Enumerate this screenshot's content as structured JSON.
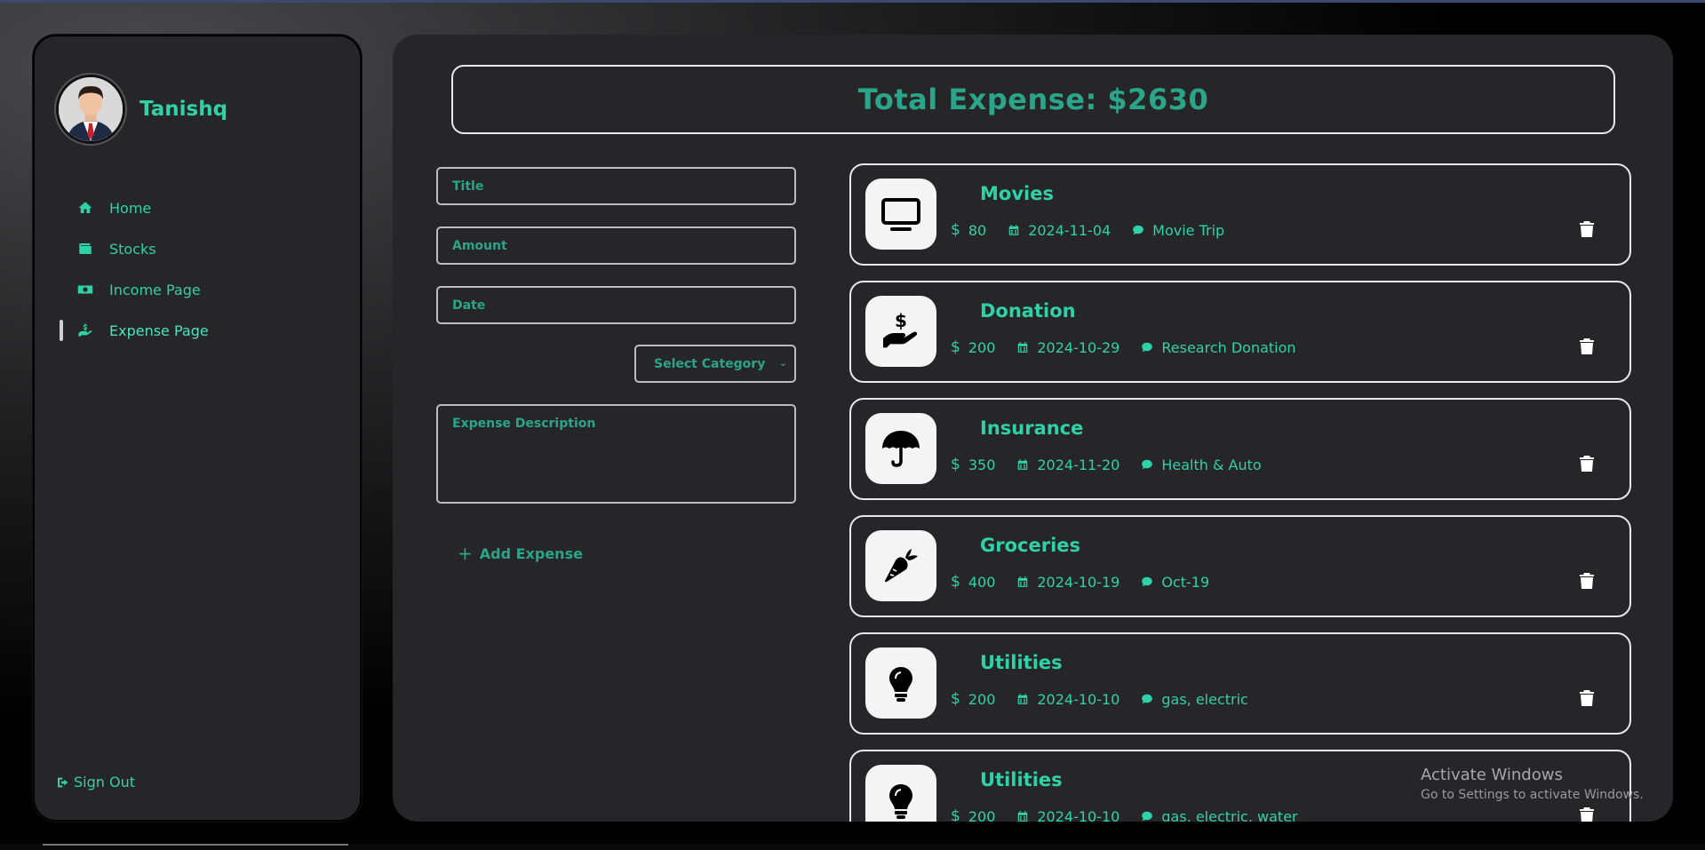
{
  "user": {
    "name": "Tanishq"
  },
  "nav": [
    {
      "label": "Home",
      "icon": "home-icon",
      "active": false
    },
    {
      "label": "Stocks",
      "icon": "wallet-icon",
      "active": false
    },
    {
      "label": "Income Page",
      "icon": "money-bill-icon",
      "active": false
    },
    {
      "label": "Expense Page",
      "icon": "hand-holding-dollar-icon",
      "active": true
    }
  ],
  "signout": {
    "label": "Sign Out"
  },
  "total": {
    "label": "Total Expense: $2630"
  },
  "form": {
    "title_placeholder": "Title",
    "amount_placeholder": "Amount",
    "date_placeholder": "Date",
    "category_selected": "Select Category",
    "description_placeholder": "Expense Description",
    "add_label": "Add Expense"
  },
  "expenses": [
    {
      "title": "Movies",
      "amount": "80",
      "date": "2024-11-04",
      "note": "Movie Trip",
      "icon": "tv-icon"
    },
    {
      "title": "Donation",
      "amount": "200",
      "date": "2024-10-29",
      "note": "Research Donation",
      "icon": "hand-holding-dollar-icon"
    },
    {
      "title": "Insurance",
      "amount": "350",
      "date": "2024-11-20",
      "note": "Health & Auto",
      "icon": "umbrella-icon"
    },
    {
      "title": "Groceries",
      "amount": "400",
      "date": "2024-10-19",
      "note": "Oct-19",
      "icon": "carrot-icon"
    },
    {
      "title": "Utilities",
      "amount": "200",
      "date": "2024-10-10",
      "note": "gas, electric",
      "icon": "lightbulb-icon"
    },
    {
      "title": "Utilities",
      "amount": "200",
      "date": "2024-10-10",
      "note": "gas, electric, water",
      "icon": "lightbulb-icon"
    }
  ],
  "watermark": {
    "line1": "Activate Windows",
    "line2": "Go to Settings to activate Windows."
  },
  "colors": {
    "accent": "#2fd1a8",
    "accent_dim": "#2aa58a",
    "panel": "#262628",
    "border": "#e8e8e8"
  }
}
